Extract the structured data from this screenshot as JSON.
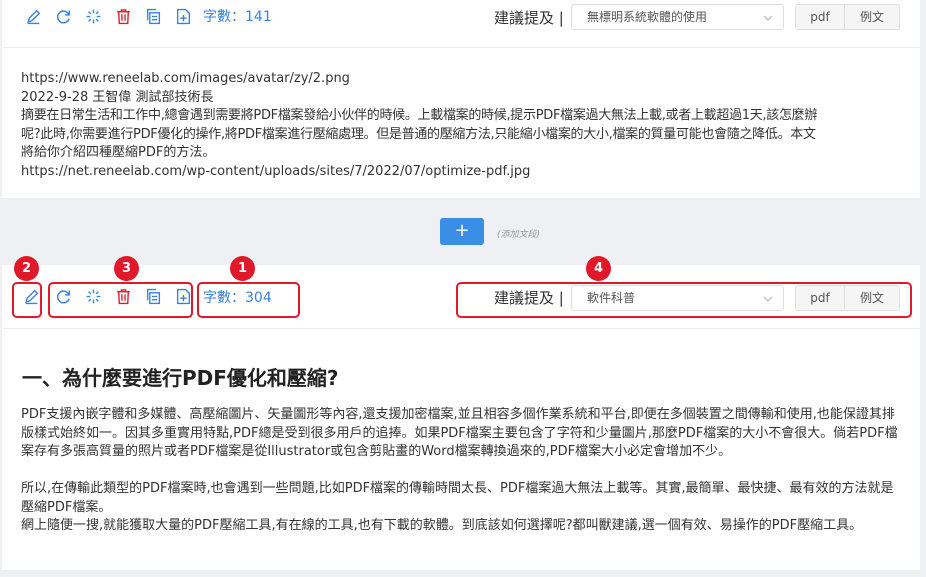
{
  "block1": {
    "count_label": "字數：",
    "count_value": "141",
    "suggest_label": "建議提及 |",
    "select_value": "無標明系統軟體的使用",
    "pdf_label": "pdf",
    "example_label": "例文",
    "lines": [
      "https://www.reneelab.com/images/avatar/zy/2.png",
      "2022-9-28 王智偉 測試部技術長",
      "摘要在日常生活和工作中,總會遇到需要將PDF檔案發給小伙伴的時候。上載檔案的時候,提示PDF檔案過大無法上載,或者上載超過1天,該怎麼辦",
      "呢?此時,你需要進行PDF優化的操作,將PDF檔案進行壓縮處理。但是普通的壓縮方法,只能縮小檔案的大小,檔案的質量可能也會隨之降低。本文",
      "將給你介紹四種壓縮PDF的方法。",
      "https://net.reneelab.com/wp-content/uploads/sites/7/2022/07/optimize-pdf.jpg"
    ]
  },
  "add": {
    "plus": "+",
    "hint": "(添加文段)"
  },
  "block2": {
    "count_label": "字數：",
    "count_value": "304",
    "suggest_label": "建議提及 |",
    "select_value": "軟件科普",
    "pdf_label": "pdf",
    "example_label": "例文",
    "heading": "一、為什麼要進行PDF優化和壓縮?",
    "paragraphs": [
      "PDF支援內嵌字體和多媒體、高壓縮圖片、矢量圖形等內容,還支援加密檔案,並且相容多個作業系統和平台,即便在多個裝置之間傳輸和使用,也能保證其排版樣式始終如一。因其多重實用特點,PDF總是受到很多用戶的追捧。如果PDF檔案主要包含了字符和少量圖片,那麼PDF檔案的大小不會很大。倘若PDF檔案存有多張高質量的照片或者PDF檔案是從Illustrator或包含剪貼畫的Word檔案轉換過來的,PDF檔案大小必定會增加不少。",
      "所以,在傳輸此類型的PDF檔案時,也會遇到一些問題,比如PDF檔案的傳輸時間太長、PDF檔案過大無法上載等。其實,最簡單、最快捷、最有效的方法就是壓縮PDF檔案。",
      "網上隨便一搜,就能獲取大量的PDF壓縮工具,有在線的工具,也有下載的軟體。到底該如何選擇呢?都叫獸建議,選一個有效、易操作的PDF壓縮工具。"
    ]
  },
  "annotations": [
    "1",
    "2",
    "3",
    "4"
  ],
  "colors": {
    "blue_icon": "#3a82e0",
    "red_icon": "#e0192a",
    "annotation": "#e0192a",
    "button_blue": "#3a8ee6"
  }
}
